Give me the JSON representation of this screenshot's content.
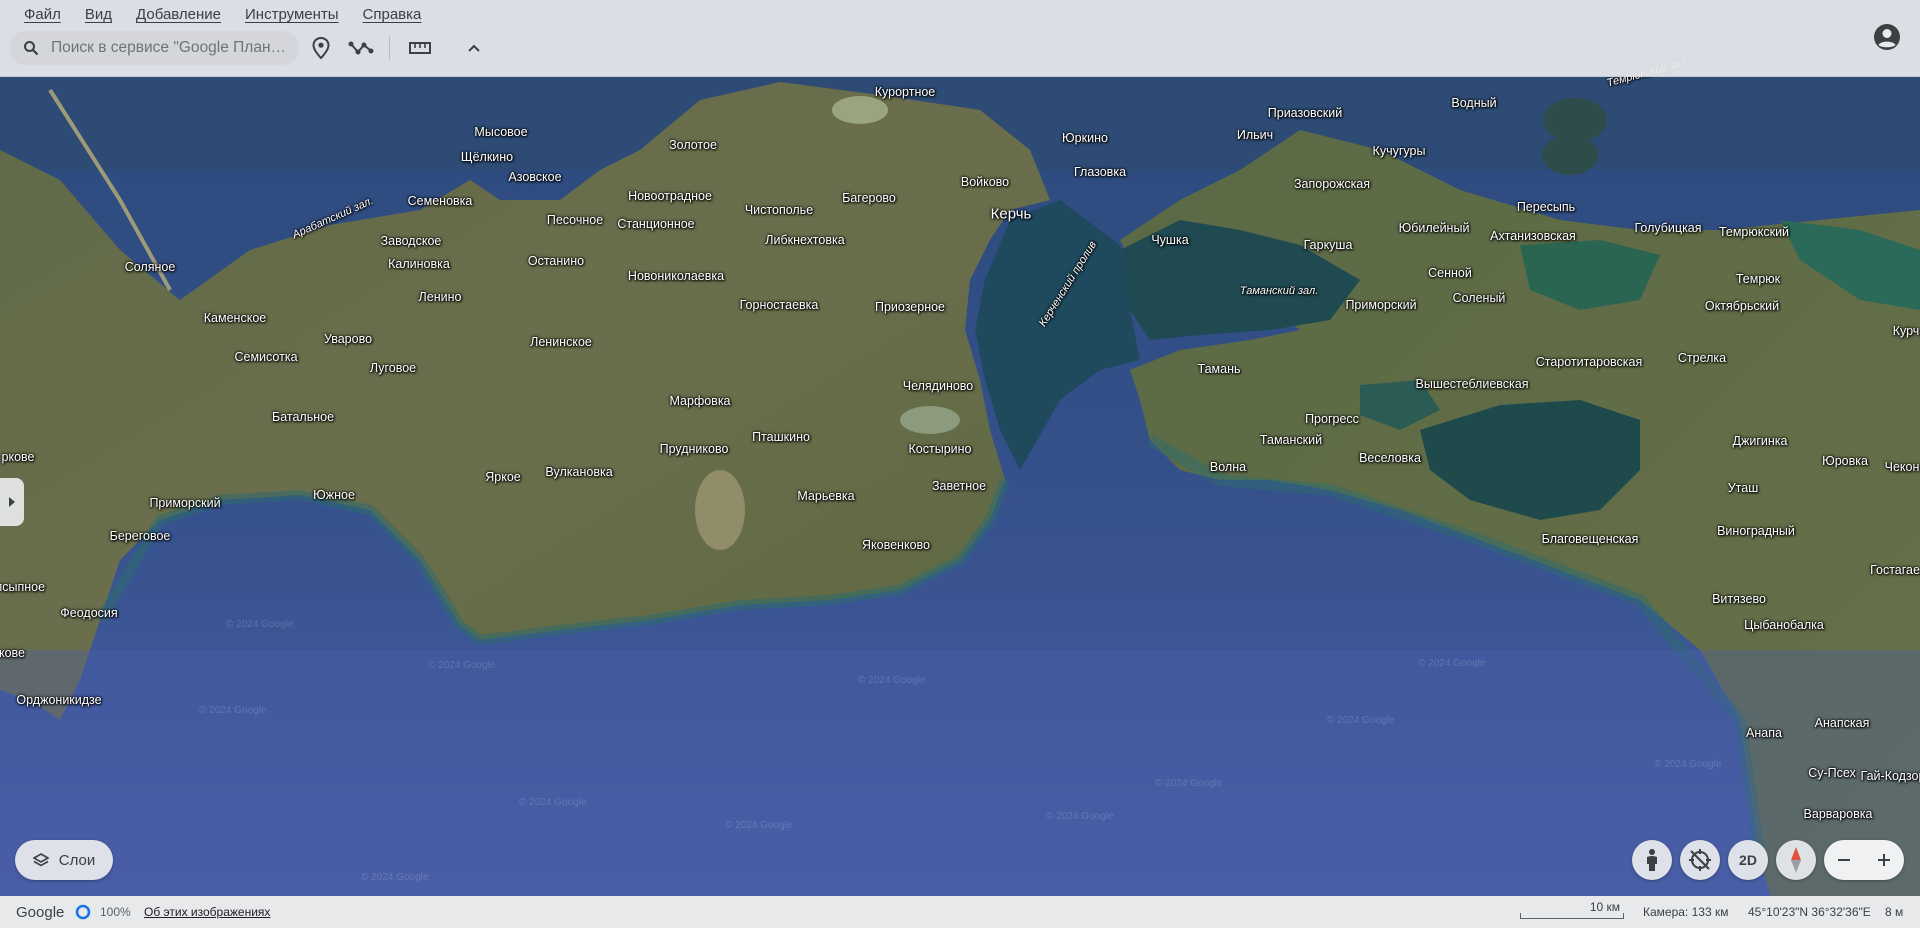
{
  "menu": {
    "items": [
      {
        "label": "Файл"
      },
      {
        "label": "Вид"
      },
      {
        "label": "Добавление"
      },
      {
        "label": "Инструменты"
      },
      {
        "label": "Справка"
      }
    ]
  },
  "search": {
    "placeholder": "Поиск в сервисе \"Google План…"
  },
  "toolbar": {
    "icons": [
      "search-icon",
      "placemark-icon",
      "path-icon",
      "ruler-icon",
      "chevron-up-icon"
    ]
  },
  "layers": {
    "label": "Слои"
  },
  "controls": {
    "view_mode": "2D"
  },
  "status": {
    "brand": "Google",
    "progress": "100%",
    "about": "Об этих изображениях",
    "scale": "10 км",
    "camera": "Камера: 133 км",
    "coords": "45°10'23\"N 36°32'36\"E",
    "elevation": "8 м"
  },
  "map": {
    "watermark": "© 2024 Google",
    "places": [
      {
        "name": "Курортное"
      },
      {
        "name": "Мысовое"
      },
      {
        "name": "Щёлкино"
      },
      {
        "name": "Азовское"
      },
      {
        "name": "Золотое"
      },
      {
        "name": "Юркино"
      },
      {
        "name": "Войково"
      },
      {
        "name": "Глазовка"
      },
      {
        "name": "Багерово"
      },
      {
        "name": "Новоотрадное"
      },
      {
        "name": "Чистополье"
      },
      {
        "name": "Семеновка"
      },
      {
        "name": "Песочное"
      },
      {
        "name": "Станционное"
      },
      {
        "name": "Керчь"
      },
      {
        "name": "Либкнехтовка"
      },
      {
        "name": "Заводское"
      },
      {
        "name": "Калиновка"
      },
      {
        "name": "Останино"
      },
      {
        "name": "Соляное"
      },
      {
        "name": "Новониколаевка"
      },
      {
        "name": "Ленино"
      },
      {
        "name": "Горностаевка"
      },
      {
        "name": "Приозерное"
      },
      {
        "name": "Каменское"
      },
      {
        "name": "Уварово"
      },
      {
        "name": "Ленинское"
      },
      {
        "name": "Семисотка"
      },
      {
        "name": "Луговое"
      },
      {
        "name": "Челядиново"
      },
      {
        "name": "Марфовка"
      },
      {
        "name": "Батальное"
      },
      {
        "name": "Пташкино"
      },
      {
        "name": "Прудниково"
      },
      {
        "name": "Костырино"
      },
      {
        "name": "Яркое"
      },
      {
        "name": "Вулкановка"
      },
      {
        "name": "Заветное"
      },
      {
        "name": "Марьевка"
      },
      {
        "name": "Южное"
      },
      {
        "name": "Приморский"
      },
      {
        "name": "Береговое"
      },
      {
        "name": "Яковенково"
      },
      {
        "name": "Феодосия"
      },
      {
        "name": "Орджоникидзе"
      },
      {
        "name": "Приазовский"
      },
      {
        "name": "Водный"
      },
      {
        "name": "Ильич"
      },
      {
        "name": "Кучугуры"
      },
      {
        "name": "Запорожская"
      },
      {
        "name": "Пересыпь"
      },
      {
        "name": "Чушка"
      },
      {
        "name": "Юбилейный"
      },
      {
        "name": "Ахтанизовская"
      },
      {
        "name": "Голубицкая"
      },
      {
        "name": "Темрюкский"
      },
      {
        "name": "Гаркуша"
      },
      {
        "name": "Темрюк"
      },
      {
        "name": "Сенной"
      },
      {
        "name": "Приморский"
      },
      {
        "name": "Соленый"
      },
      {
        "name": "Октябрьский"
      },
      {
        "name": "Тамань"
      },
      {
        "name": "Старотитаровская"
      },
      {
        "name": "Стрелка"
      },
      {
        "name": "Вышестеблиевская"
      },
      {
        "name": "Прогресс"
      },
      {
        "name": "Таманский"
      },
      {
        "name": "Джигинка"
      },
      {
        "name": "Волна"
      },
      {
        "name": "Веселовка"
      },
      {
        "name": "Юровка"
      },
      {
        "name": "Уташ"
      },
      {
        "name": "Виноградный"
      },
      {
        "name": "Благовещенская"
      },
      {
        "name": "Витязево"
      },
      {
        "name": "Цыбанобалка"
      },
      {
        "name": "Анапа"
      },
      {
        "name": "Анапская"
      },
      {
        "name": "Су-Псех"
      },
      {
        "name": "Гай-Кодзор"
      },
      {
        "name": "Варваровка"
      },
      {
        "name": "Гостагае"
      },
      {
        "name": "Чекон"
      },
      {
        "name": "Курч"
      },
      {
        "name": "лсыпное"
      },
      {
        "name": "ркове"
      },
      {
        "name": "кове"
      }
    ],
    "water_labels": [
      {
        "name": "Арабатский зал."
      },
      {
        "name": "Керченский пролив"
      },
      {
        "name": "Таманский зал."
      },
      {
        "name": "Темрюкский зал"
      }
    ]
  }
}
